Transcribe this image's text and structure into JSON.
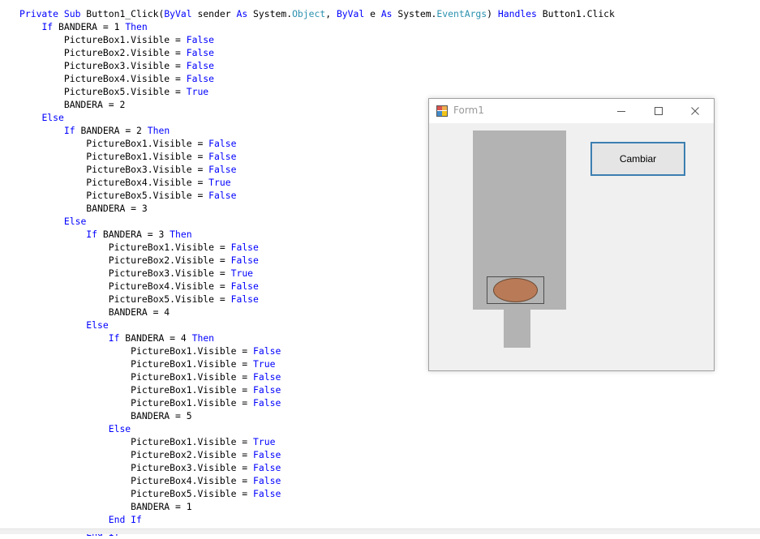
{
  "code_lines": [
    [
      [
        "Private Sub ",
        "kw"
      ],
      [
        "Button1_Click(",
        ""
      ],
      [
        "ByVal",
        "kw"
      ],
      [
        " sender ",
        ""
      ],
      [
        "As",
        "kw"
      ],
      [
        " System.",
        ""
      ],
      [
        "Object",
        "ty"
      ],
      [
        ", ",
        ""
      ],
      [
        "ByVal",
        "kw"
      ],
      [
        " e ",
        ""
      ],
      [
        "As",
        "kw"
      ],
      [
        " System.",
        ""
      ],
      [
        "EventArgs",
        "ty"
      ],
      [
        ") ",
        ""
      ],
      [
        "Handles",
        "kw"
      ],
      [
        " Button1.Click",
        ""
      ]
    ],
    [
      [
        "    ",
        ""
      ],
      [
        "If",
        "kw"
      ],
      [
        " BANDERA = 1 ",
        ""
      ],
      [
        "Then",
        "kw"
      ]
    ],
    [
      [
        "        PictureBox1.Visible = ",
        ""
      ],
      [
        "False",
        "kw"
      ]
    ],
    [
      [
        "        PictureBox2.Visible = ",
        ""
      ],
      [
        "False",
        "kw"
      ]
    ],
    [
      [
        "        PictureBox3.Visible = ",
        ""
      ],
      [
        "False",
        "kw"
      ]
    ],
    [
      [
        "        PictureBox4.Visible = ",
        ""
      ],
      [
        "False",
        "kw"
      ]
    ],
    [
      [
        "        PictureBox5.Visible = ",
        ""
      ],
      [
        "True",
        "kw"
      ]
    ],
    [
      [
        "        BANDERA = 2",
        ""
      ]
    ],
    [
      [
        "    ",
        ""
      ],
      [
        "Else",
        "kw"
      ]
    ],
    [
      [
        "        ",
        ""
      ],
      [
        "If",
        "kw"
      ],
      [
        " BANDERA = 2 ",
        ""
      ],
      [
        "Then",
        "kw"
      ]
    ],
    [
      [
        "            PictureBox1.Visible = ",
        ""
      ],
      [
        "False",
        "kw"
      ]
    ],
    [
      [
        "            PictureBox1.Visible = ",
        ""
      ],
      [
        "False",
        "kw"
      ]
    ],
    [
      [
        "            PictureBox3.Visible = ",
        ""
      ],
      [
        "False",
        "kw"
      ]
    ],
    [
      [
        "            PictureBox4.Visible = ",
        ""
      ],
      [
        "True",
        "kw"
      ]
    ],
    [
      [
        "            PictureBox5.Visible = ",
        ""
      ],
      [
        "False",
        "kw"
      ]
    ],
    [
      [
        "            BANDERA = 3",
        ""
      ]
    ],
    [
      [
        "        ",
        ""
      ],
      [
        "Else",
        "kw"
      ]
    ],
    [
      [
        "            ",
        ""
      ],
      [
        "If",
        "kw"
      ],
      [
        " BANDERA = 3 ",
        ""
      ],
      [
        "Then",
        "kw"
      ]
    ],
    [
      [
        "                PictureBox1.Visible = ",
        ""
      ],
      [
        "False",
        "kw"
      ]
    ],
    [
      [
        "                PictureBox2.Visible = ",
        ""
      ],
      [
        "False",
        "kw"
      ]
    ],
    [
      [
        "                PictureBox3.Visible = ",
        ""
      ],
      [
        "True",
        "kw"
      ]
    ],
    [
      [
        "                PictureBox4.Visible = ",
        ""
      ],
      [
        "False",
        "kw"
      ]
    ],
    [
      [
        "                PictureBox5.Visible = ",
        ""
      ],
      [
        "False",
        "kw"
      ]
    ],
    [
      [
        "                BANDERA = 4",
        ""
      ]
    ],
    [
      [
        "            ",
        ""
      ],
      [
        "Else",
        "kw"
      ]
    ],
    [
      [
        "                ",
        ""
      ],
      [
        "If",
        "kw"
      ],
      [
        " BANDERA = 4 ",
        ""
      ],
      [
        "Then",
        "kw"
      ]
    ],
    [
      [
        "                    PictureBox1.Visible = ",
        ""
      ],
      [
        "False",
        "kw"
      ]
    ],
    [
      [
        "                    PictureBox1.Visible = ",
        ""
      ],
      [
        "True",
        "kw"
      ]
    ],
    [
      [
        "                    PictureBox1.Visible = ",
        ""
      ],
      [
        "False",
        "kw"
      ]
    ],
    [
      [
        "                    PictureBox1.Visible = ",
        ""
      ],
      [
        "False",
        "kw"
      ]
    ],
    [
      [
        "                    PictureBox1.Visible = ",
        ""
      ],
      [
        "False",
        "kw"
      ]
    ],
    [
      [
        "                    BANDERA = 5",
        ""
      ]
    ],
    [
      [
        "                ",
        ""
      ],
      [
        "Else",
        "kw"
      ]
    ],
    [
      [
        "                    PictureBox1.Visible = ",
        ""
      ],
      [
        "True",
        "kw"
      ]
    ],
    [
      [
        "                    PictureBox2.Visible = ",
        ""
      ],
      [
        "False",
        "kw"
      ]
    ],
    [
      [
        "                    PictureBox3.Visible = ",
        ""
      ],
      [
        "False",
        "kw"
      ]
    ],
    [
      [
        "                    PictureBox4.Visible = ",
        ""
      ],
      [
        "False",
        "kw"
      ]
    ],
    [
      [
        "                    PictureBox5.Visible = ",
        ""
      ],
      [
        "False",
        "kw"
      ]
    ],
    [
      [
        "                    BANDERA = 1",
        ""
      ]
    ],
    [
      [
        "                ",
        ""
      ],
      [
        "End If",
        "kw"
      ]
    ],
    [
      [
        "            ",
        ""
      ],
      [
        "End If",
        "kw"
      ]
    ]
  ],
  "form": {
    "title": "Form1",
    "icon": "winforms-app-icon",
    "controls": {
      "minimize": "minimize-icon",
      "maximize": "maximize-icon",
      "close": "close-icon"
    },
    "button_label": "Cambiar",
    "colors": {
      "picture_gray": "#b3b3b3",
      "oval_fill": "#b97a57",
      "button_border": "#3c7fb1"
    }
  },
  "colors": {
    "keyword": "#0000ff",
    "type": "#2b91af"
  }
}
